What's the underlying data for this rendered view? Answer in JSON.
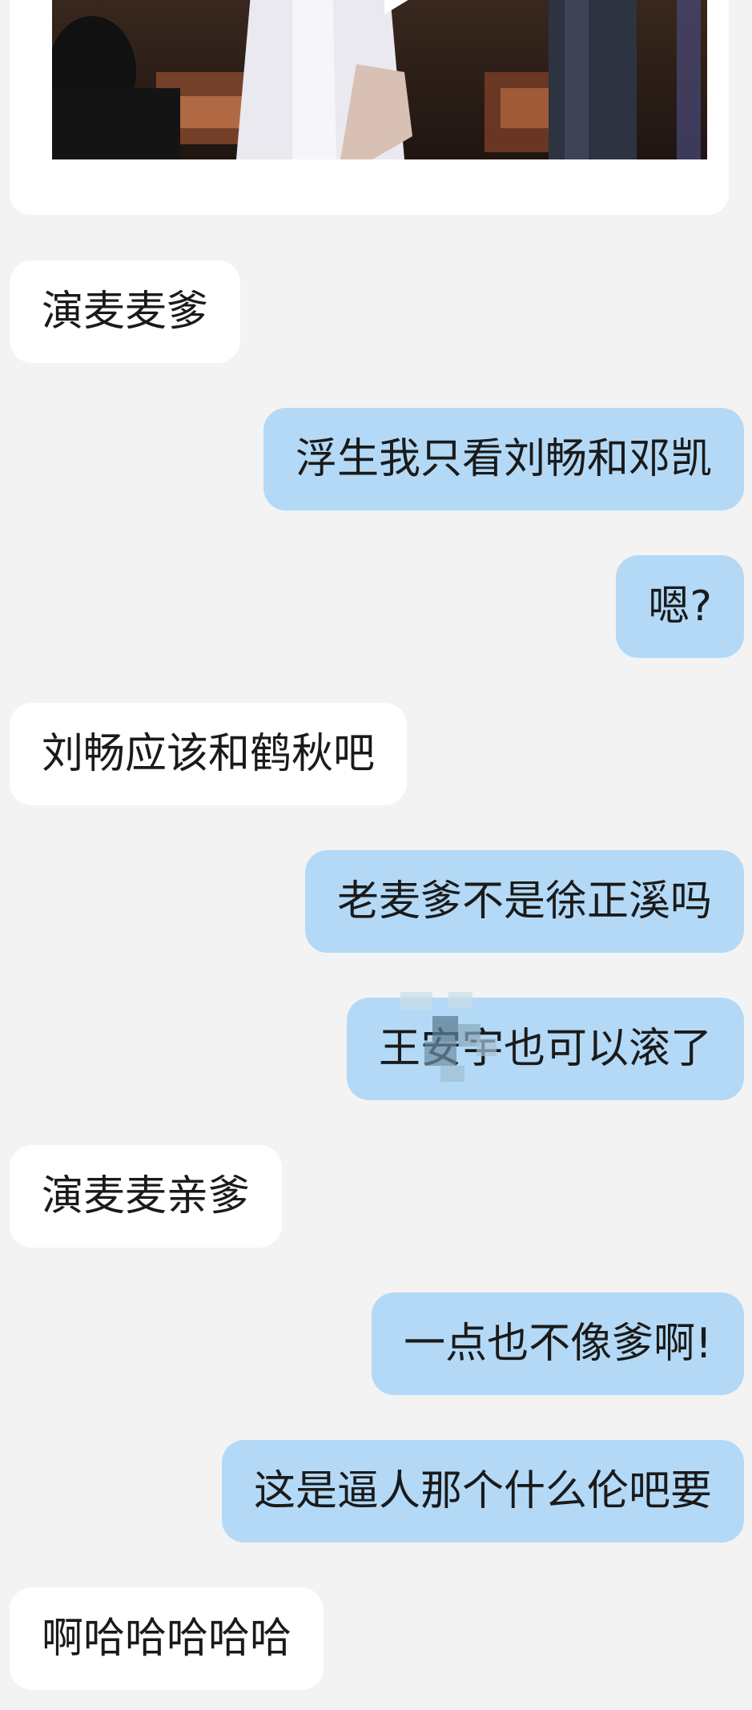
{
  "video_card": {
    "play_icon": "play-icon"
  },
  "messages": [
    {
      "side": "left",
      "text": "演麦麦爹"
    },
    {
      "side": "right",
      "text": "浮生我只看刘畅和邓凯"
    },
    {
      "side": "right",
      "text": "嗯?"
    },
    {
      "side": "left",
      "text": "刘畅应该和鹤秋吧"
    },
    {
      "side": "right",
      "text": "老麦爹不是徐正溪吗"
    },
    {
      "side": "right",
      "text": "王安宇也可以滚了"
    },
    {
      "side": "left",
      "text": "演麦麦亲爹"
    },
    {
      "side": "right",
      "text": "一点也不像爹啊!"
    },
    {
      "side": "right",
      "text": "这是逼人那个什么伦吧要"
    },
    {
      "side": "left",
      "text": "啊哈哈哈哈哈"
    }
  ],
  "colors": {
    "background": "#f3f3f3",
    "incoming_bubble": "#ffffff",
    "outgoing_bubble": "#b3d9f6",
    "text": "#1a1a1a"
  }
}
